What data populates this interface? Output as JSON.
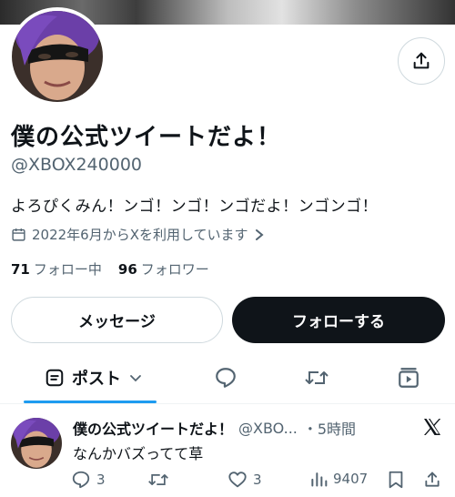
{
  "profile": {
    "display_name": "僕の公式ツイートだよ！",
    "handle": "@XBOX240000",
    "bio": "よろぴくみん！ンゴ！ンゴ！ンゴだよ！ンゴンゴ！",
    "joined": "2022年6月からXを利用しています",
    "following_count": "71",
    "following_label": "フォロー中",
    "followers_count": "96",
    "followers_label": "フォロワー"
  },
  "buttons": {
    "message": "メッセージ",
    "follow": "フォローする"
  },
  "tabs": {
    "posts_label": "ポスト"
  },
  "tweet": {
    "author_name": "僕の公式ツイートだよ！",
    "author_handle": "@XBO...",
    "time": "・5時間",
    "text": "なんかバズってて草",
    "replies": "3",
    "likes": "3",
    "views": "9407"
  },
  "colors": {
    "text": "#0f1419",
    "secondary": "#536471",
    "accent": "#1d9bf0",
    "border": "#cfd9de"
  },
  "icons": {
    "share": "share-icon",
    "calendar": "calendar-icon",
    "posts_tab": "list-icon",
    "replies_tab": "speech-bubble-icon",
    "reposts_tab": "repost-icon",
    "media_tab": "video-icon",
    "platform": "x-logo-icon"
  }
}
